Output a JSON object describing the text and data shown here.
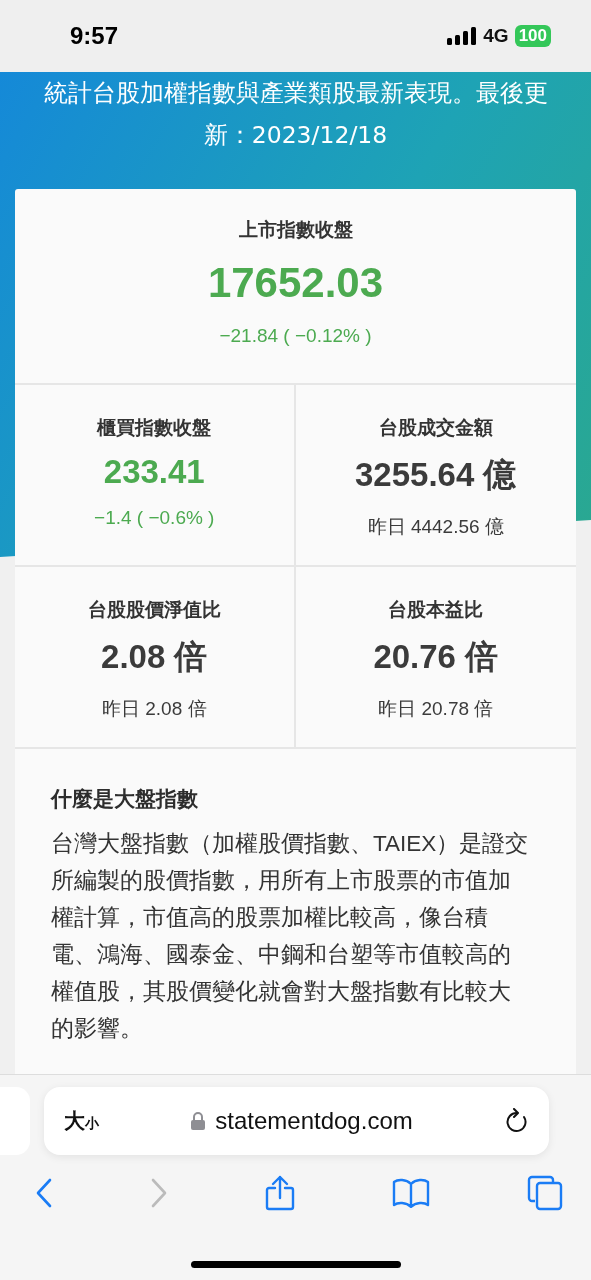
{
  "status_bar": {
    "time": "9:57",
    "network": "4G",
    "battery": "100"
  },
  "header": {
    "description": "統計台股加權指數與產業類股最新表現。最後更新：2023/12/18"
  },
  "main_index": {
    "label": "上市指數收盤",
    "value": "17652.03",
    "change": "−21.84 ( −0.12% )",
    "color": "#4caa50"
  },
  "metrics": [
    {
      "label": "櫃買指數收盤",
      "value": "233.41",
      "sub": "−1.4 ( −0.6% )",
      "color": "#4caa50"
    },
    {
      "label": "台股成交金額",
      "value": "3255.64 億",
      "sub": "昨日 4442.56 億",
      "color": "#3b3b3b"
    },
    {
      "label": "台股股價淨值比",
      "value": "2.08 倍",
      "sub": "昨日 2.08 倍",
      "color": "#3b3b3b"
    },
    {
      "label": "台股本益比",
      "value": "20.76 倍",
      "sub": "昨日 20.78 倍",
      "color": "#3b3b3b"
    }
  ],
  "explainer": {
    "title": "什麼是大盤指數",
    "body": "台灣大盤指數（加權股價指數、TAIEX）是證交所編製的股價指數，用所有上市股票的市值加權計算，市值高的股票加權比較高，像台積電、鴻海、國泰金、中鋼和台塑等市值較高的權值股，其股價變化就會對大盤指數有比較大的影響。"
  },
  "browser": {
    "text_size": {
      "large": "大",
      "small": "小"
    },
    "url": "statementdog.com",
    "back_disabled": false,
    "forward_disabled": true
  }
}
